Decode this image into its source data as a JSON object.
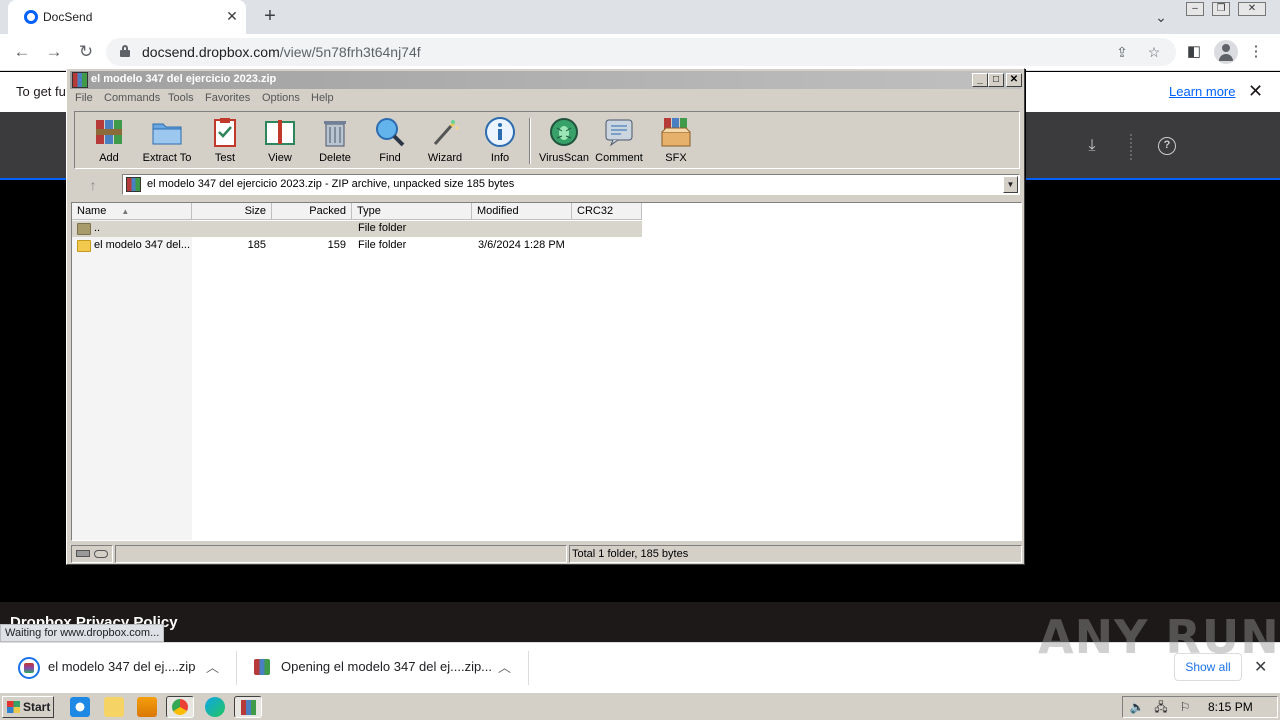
{
  "browser": {
    "tab_title": "DocSend",
    "tab_close": "✕",
    "new_tab": "+",
    "url_host": "docsend.dropbox.com",
    "url_path": "/view/5n78frh3t64nj74f"
  },
  "page": {
    "banner_text": "To get fu",
    "banner_link": "Learn more",
    "banner_close": "✕",
    "footer_text": "Dropbox Privacy Policy",
    "status_text": "Waiting for www.dropbox.com..."
  },
  "winrar": {
    "title": "el modelo 347 del ejercicio 2023.zip",
    "menu": [
      "File",
      "Commands",
      "Tools",
      "Favorites",
      "Options",
      "Help"
    ],
    "tools": [
      {
        "label": "Add",
        "icon": "add-archive-icon"
      },
      {
        "label": "Extract To",
        "icon": "extract-folder-icon"
      },
      {
        "label": "Test",
        "icon": "test-clipboard-icon"
      },
      {
        "label": "View",
        "icon": "view-book-icon"
      },
      {
        "label": "Delete",
        "icon": "delete-trash-icon"
      },
      {
        "label": "Find",
        "icon": "find-magnifier-icon"
      },
      {
        "label": "Wizard",
        "icon": "wizard-wand-icon"
      },
      {
        "label": "Info",
        "icon": "info-icon"
      },
      {
        "label": "VirusScan",
        "icon": "virusscan-bug-icon"
      },
      {
        "label": "Comment",
        "icon": "comment-icon"
      },
      {
        "label": "SFX",
        "icon": "sfx-box-icon"
      }
    ],
    "address": "el modelo 347 del ejercicio 2023.zip - ZIP archive, unpacked size 185 bytes",
    "columns": [
      "Name",
      "Size",
      "Packed",
      "Type",
      "Modified",
      "CRC32"
    ],
    "rows": [
      {
        "name": "..",
        "size": "",
        "packed": "",
        "type": "File folder",
        "modified": "",
        "crc": ""
      },
      {
        "name": "el modelo 347 del...",
        "size": "185",
        "packed": "159",
        "type": "File folder",
        "modified": "3/6/2024 1:28 PM",
        "crc": ""
      }
    ],
    "status": "Total 1 folder, 185 bytes"
  },
  "downloads": {
    "item1": "el modelo 347 del ej....zip",
    "item2": "Opening el modelo 347 del ej....zip...",
    "show_all": "Show all"
  },
  "watermark": "ANY RUN",
  "taskbar": {
    "start": "Start",
    "clock": "8:15 PM"
  },
  "colors": {
    "dropbox_blue": "#0061fe",
    "link_blue": "#1a73e8",
    "win_gray": "#d4d0c8"
  }
}
